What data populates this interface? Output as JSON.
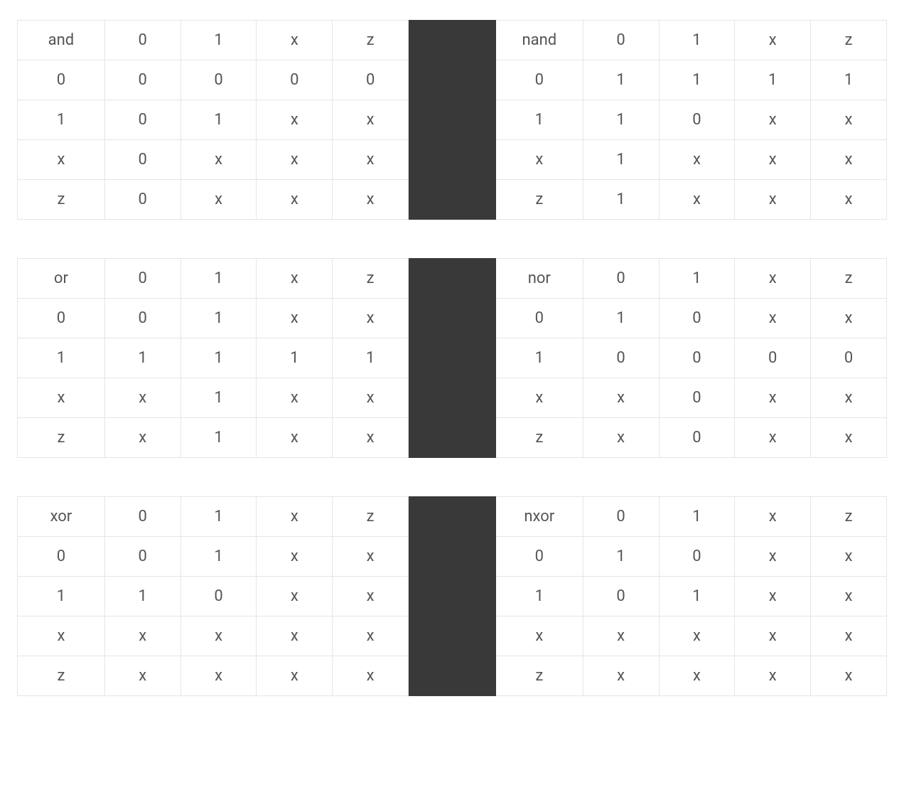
{
  "columns": [
    "0",
    "1",
    "x",
    "z"
  ],
  "row_labels": [
    "0",
    "1",
    "x",
    "z"
  ],
  "pairs": [
    {
      "left": {
        "name": "and",
        "rows": [
          [
            "0",
            "0",
            "0",
            "0"
          ],
          [
            "0",
            "1",
            "x",
            "x"
          ],
          [
            "0",
            "x",
            "x",
            "x"
          ],
          [
            "0",
            "x",
            "x",
            "x"
          ]
        ]
      },
      "right": {
        "name": "nand",
        "rows": [
          [
            "1",
            "1",
            "1",
            "1"
          ],
          [
            "1",
            "0",
            "x",
            "x"
          ],
          [
            "1",
            "x",
            "x",
            "x"
          ],
          [
            "1",
            "x",
            "x",
            "x"
          ]
        ]
      }
    },
    {
      "left": {
        "name": "or",
        "rows": [
          [
            "0",
            "1",
            "x",
            "x"
          ],
          [
            "1",
            "1",
            "1",
            "1"
          ],
          [
            "x",
            "1",
            "x",
            "x"
          ],
          [
            "x",
            "1",
            "x",
            "x"
          ]
        ]
      },
      "right": {
        "name": "nor",
        "rows": [
          [
            "1",
            "0",
            "x",
            "x"
          ],
          [
            "0",
            "0",
            "0",
            "0"
          ],
          [
            "x",
            "0",
            "x",
            "x"
          ],
          [
            "x",
            "0",
            "x",
            "x"
          ]
        ]
      }
    },
    {
      "left": {
        "name": "xor",
        "rows": [
          [
            "0",
            "1",
            "x",
            "x"
          ],
          [
            "1",
            "0",
            "x",
            "x"
          ],
          [
            "x",
            "x",
            "x",
            "x"
          ],
          [
            "x",
            "x",
            "x",
            "x"
          ]
        ]
      },
      "right": {
        "name": "nxor",
        "rows": [
          [
            "1",
            "0",
            "x",
            "x"
          ],
          [
            "0",
            "1",
            "x",
            "x"
          ],
          [
            "x",
            "x",
            "x",
            "x"
          ],
          [
            "x",
            "x",
            "x",
            "x"
          ]
        ]
      }
    }
  ]
}
